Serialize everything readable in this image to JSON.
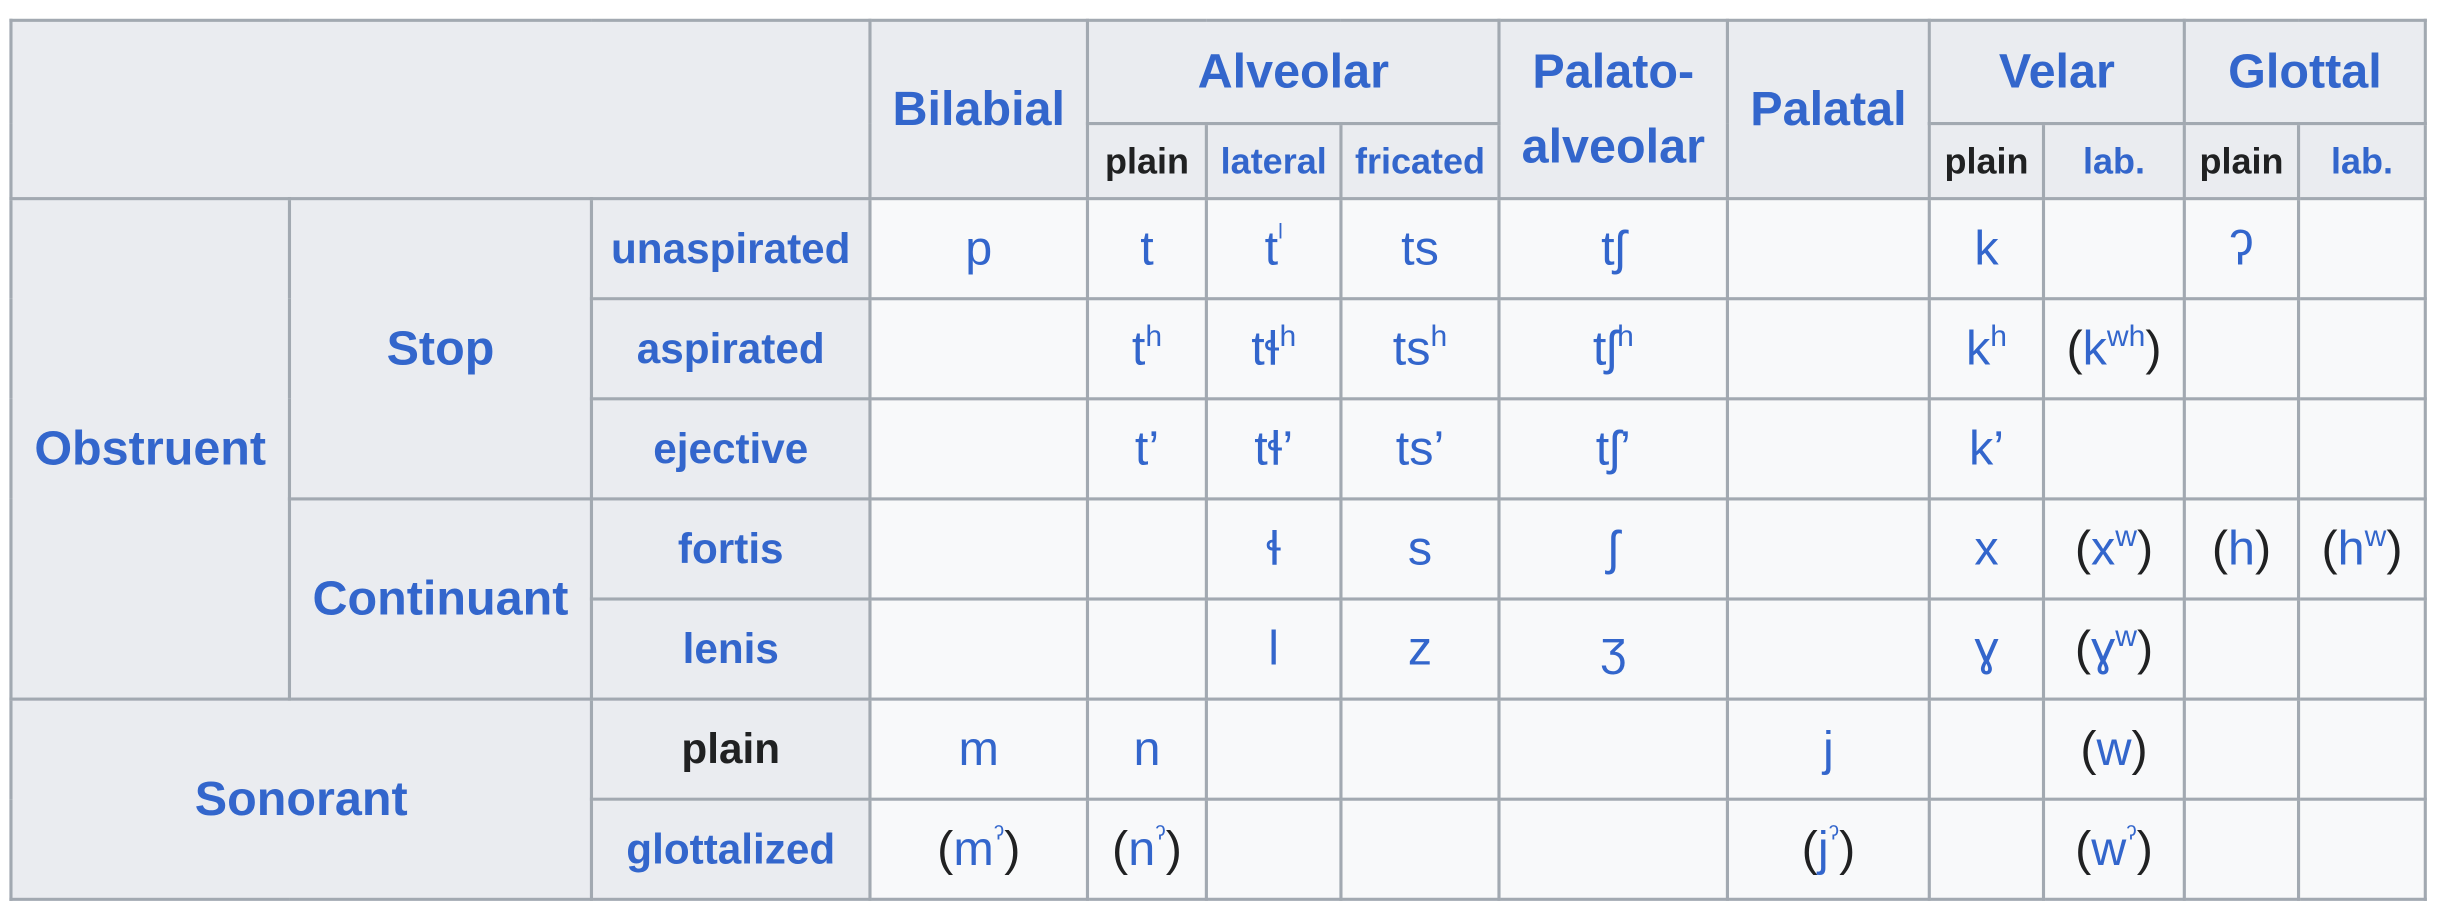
{
  "columns": {
    "bilabial": "Bilabial",
    "alveolar": "Alveolar",
    "alveolar_plain": "plain",
    "alveolar_lateral": "lateral",
    "alveolar_fricated": "fricated",
    "palato_alveolar_1": "Palato-",
    "palato_alveolar_2": "alveolar",
    "palatal": "Palatal",
    "velar": "Velar",
    "velar_plain": "plain",
    "velar_lab": "lab.",
    "glottal": "Glottal",
    "glottal_plain": "plain",
    "glottal_lab": "lab."
  },
  "rows": {
    "obstruent": "Obstruent",
    "stop": "Stop",
    "continuant": "Continuant",
    "sonorant": "Sonorant",
    "unaspirated": "unaspirated",
    "aspirated": "aspirated",
    "ejective": "ejective",
    "fortis": "fortis",
    "lenis": "lenis",
    "plain": "plain",
    "glottalized": "glottalized"
  },
  "cells": {
    "unaspirated": {
      "bilabial": "p",
      "alv_plain": "t",
      "alv_lat_base": "t",
      "alv_lat_sup": "ˡ",
      "alv_fric": "ts",
      "palato": "tʃ",
      "velar": "k",
      "glottal": "ʔ"
    },
    "aspirated": {
      "alv_plain_base": "t",
      "alv_plain_sup": "h",
      "alv_lat_base": "tɬ",
      "alv_lat_sup": "h",
      "alv_fric_base": "ts",
      "alv_fric_sup": "h",
      "palato_base": "tʃ",
      "palato_sup": "h",
      "velar_base": "k",
      "velar_sup": "h",
      "velar_lab_open": "(",
      "velar_lab_base": "k",
      "velar_lab_sup": "wh",
      "velar_lab_close": ")"
    },
    "ejective": {
      "alv_plain": "t’",
      "alv_lat": "tɬ’",
      "alv_fric": "ts’",
      "palato": "tʃ’",
      "velar": "k’"
    },
    "fortis": {
      "alv_lat": "ɬ",
      "alv_fric": "s",
      "palato": "ʃ",
      "velar": "x",
      "velar_lab_open": "(",
      "velar_lab_base": "x",
      "velar_lab_sup": "w",
      "velar_lab_close": ")",
      "glottal_open": "(",
      "glottal_base": "h",
      "glottal_close": ")",
      "glottal_lab_open": "(",
      "glottal_lab_base": "h",
      "glottal_lab_sup": "w",
      "glottal_lab_close": ")"
    },
    "lenis": {
      "alv_lat": "l",
      "alv_fric": "z",
      "palato": "ʒ",
      "velar": "ɣ",
      "velar_lab_open": "(",
      "velar_lab_base": "ɣ",
      "velar_lab_sup": "w",
      "velar_lab_close": ")"
    },
    "sonorant_plain": {
      "bilabial": "m",
      "alv_plain": "n",
      "palatal": "j",
      "velar_lab_open": "(",
      "velar_lab_base": "w",
      "velar_lab_close": ")"
    },
    "glottalized": {
      "bilabial_open": "(",
      "bilabial_base": "m",
      "bilabial_sup": "ˀ",
      "bilabial_close": ")",
      "alv_open": "(",
      "alv_base": "n",
      "alv_sup": "ˀ",
      "alv_close": ")",
      "palatal_open": "(",
      "palatal_base": "j",
      "palatal_sup": "ˀ",
      "palatal_close": ")",
      "velar_lab_open": "(",
      "velar_lab_base": "w",
      "velar_lab_sup": "ˀ",
      "velar_lab_close": ")"
    }
  },
  "colors": {
    "link": "#3366cc",
    "text": "#202122",
    "header_bg": "#eaecf0",
    "cell_bg": "#f8f9fa",
    "border": "#a2a9b1"
  }
}
